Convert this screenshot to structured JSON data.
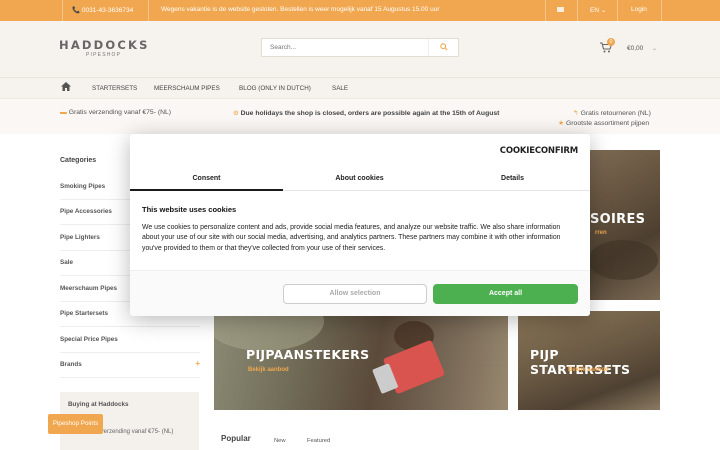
{
  "topbar": {
    "phone": "📞 0031-43-3636734",
    "notice": "Wegens vakantie is de website gesloten. Bestellen is weer mogelijk vanaf 15 Augustus 15.00 uur",
    "language": "EN ⌄",
    "login": "Login"
  },
  "header": {
    "logo": "HADDOCKS",
    "logo_sub": "PIPESHOP",
    "search_placeholder": "Search...",
    "cart_count": "0",
    "cart_total": "€0,00",
    "cart_chevron": "⌄"
  },
  "nav": {
    "home_icon": "home-icon",
    "items": [
      "STARTERSETS",
      "MEERSCHAUM PIPES",
      "BLOG (ONLY IN DUTCH)",
      "SALE"
    ]
  },
  "usp": {
    "left": "Gratis verzending vanaf €75- (NL)",
    "center": "Due holidays the shop is closed, orders are possible again at the 15th of August",
    "right1": "Gratis retourneren (NL)",
    "right2": "Grootste assortiment pijpen"
  },
  "sidebar": {
    "title": "Categories",
    "items": [
      "Smoking Pipes",
      "Pipe Accessories",
      "Pipe Lighters",
      "Sale",
      "Meerschaum Pipes",
      "Pipe Startersets",
      "Special Price Pipes",
      "Brands"
    ],
    "expand": "+",
    "buying_title": "Buying at Haddocks",
    "buying_item": "Gratis verzending vanaf €75- (NL)",
    "points_button": "Pipeshop Points"
  },
  "banners": {
    "accessories_title": "SOIRES",
    "accessories_sub": "rren",
    "lighters_title": "PIJPAANSTEKERS",
    "lighters_sub": "Bekijk aanbod",
    "startersets_title": "PIJP STARTERSETS",
    "startersets_sub": "Bekijk aanbod"
  },
  "popular": {
    "title": "Popular",
    "tabs": [
      "New",
      "Featured"
    ]
  },
  "cookie_modal": {
    "logo": "COOKIECONFIRM",
    "tabs": [
      "Consent",
      "About cookies",
      "Details"
    ],
    "title": "This website uses cookies",
    "text": "We use cookies to personalize content and ads, provide social media features, and analyze our website traffic. We also share information about your use of our site with our social media, advertising, and analytics partners. These partners may combine it with other information you've provided to them or that they've collected from your use of their services.",
    "allow_selection": "Allow selection",
    "accept_all": "Accept all"
  },
  "colors": {
    "accent": "#f0a74f",
    "accept_green": "#4caf50"
  }
}
